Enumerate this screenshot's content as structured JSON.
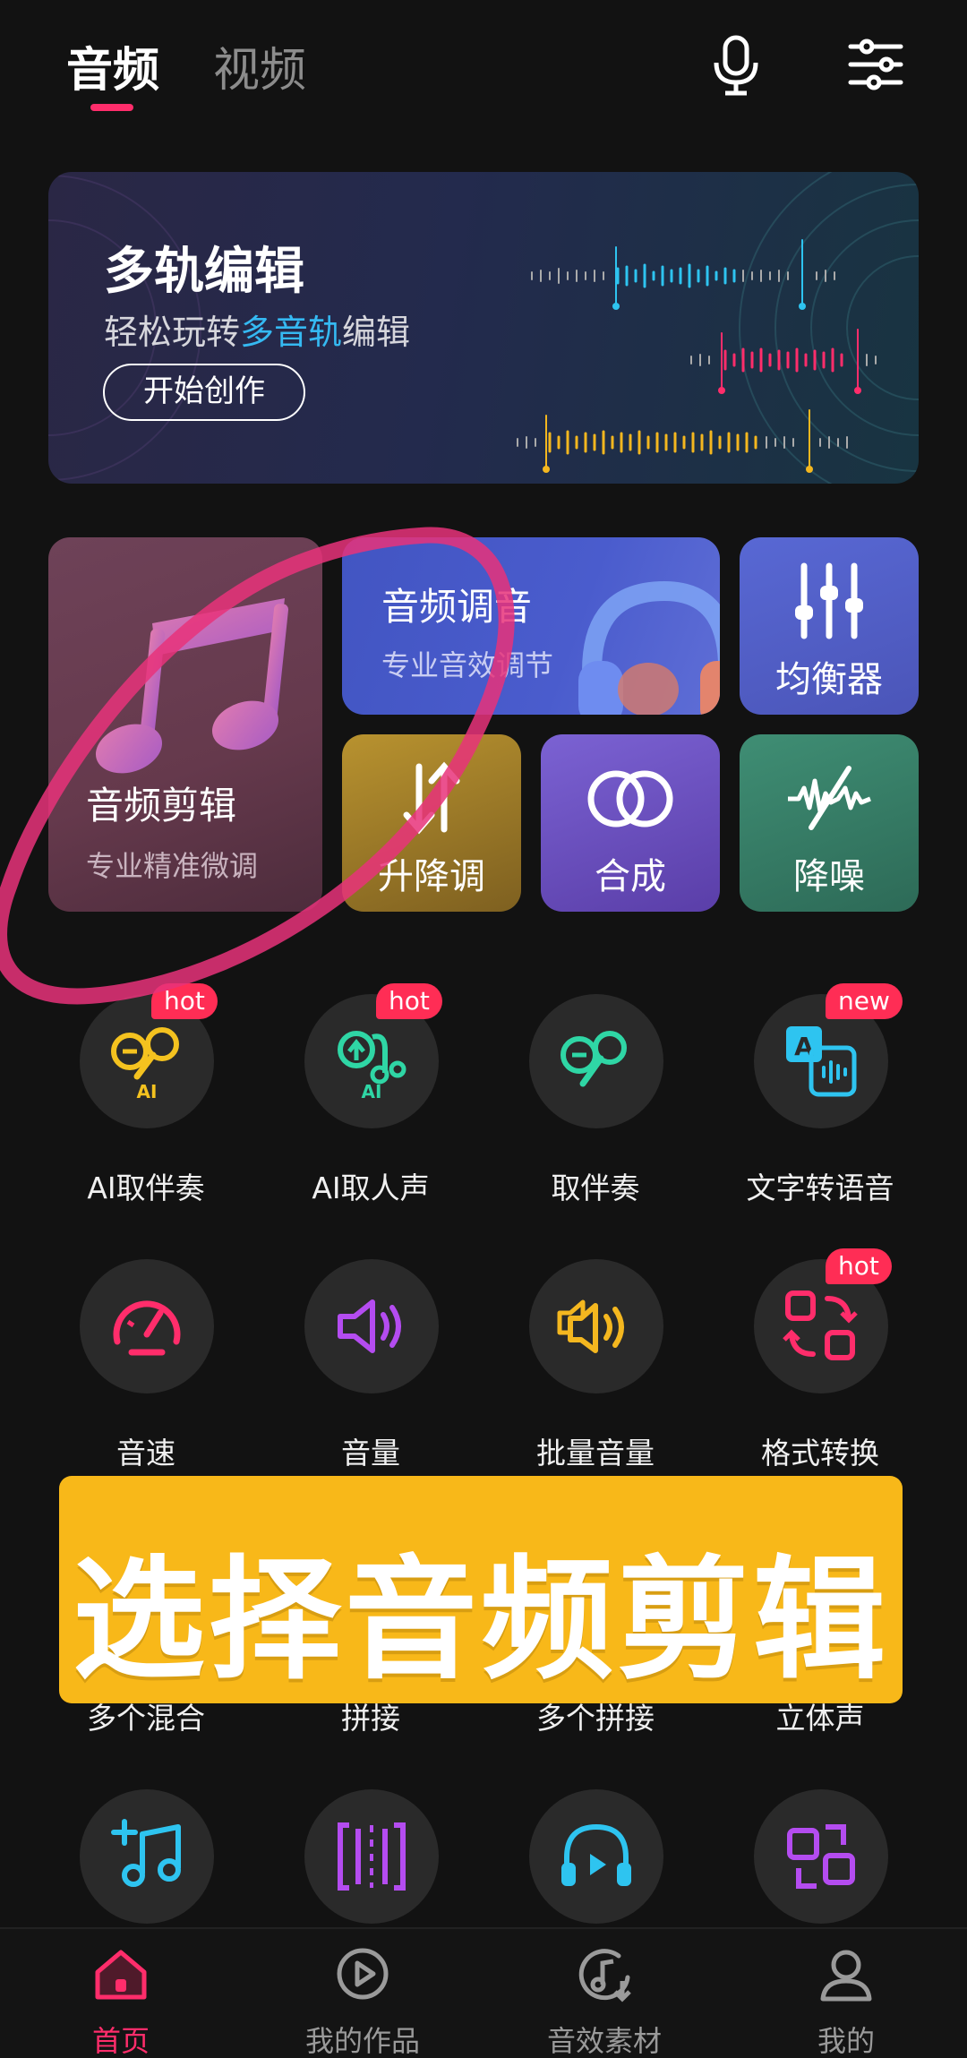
{
  "header": {
    "tabs": [
      {
        "label": "音频",
        "active": true
      },
      {
        "label": "视频",
        "active": false
      }
    ],
    "icons": [
      "microphone-icon",
      "settings-sliders-icon"
    ],
    "accent_color": "#ff2d6b"
  },
  "banner": {
    "title": "多轨编辑",
    "subtitle_prefix": "轻松玩转",
    "subtitle_highlight": "多音轨",
    "subtitle_suffix": "编辑",
    "button_label": "开始创作",
    "waveform_colors": [
      "#2ec4f0",
      "#ff2d6b",
      "#f4b71f"
    ]
  },
  "features": {
    "audio_edit": {
      "title": "音频剪辑",
      "subtitle": "专业精准微调",
      "icon": "music-note-icon"
    },
    "audio_tune": {
      "title": "音频调音",
      "subtitle": "专业音效调节",
      "icon": "headphones-icon"
    },
    "equalizer": {
      "title": "均衡器",
      "icon": "equalizer-icon"
    },
    "pitch": {
      "title": "升降调",
      "icon": "up-down-arrows-icon"
    },
    "mix": {
      "title": "合成",
      "icon": "interlocked-rings-icon"
    },
    "denoise": {
      "title": "降噪",
      "icon": "noise-wave-icon"
    }
  },
  "tools": [
    {
      "label": "AI取伴奏",
      "badge": "hot",
      "icon": "ai-accompaniment-icon",
      "color": "#f4c21f"
    },
    {
      "label": "AI取人声",
      "badge": "hot",
      "icon": "ai-vocal-icon",
      "color": "#2fd6a5"
    },
    {
      "label": "取伴奏",
      "badge": "",
      "icon": "accompaniment-icon",
      "color": "#2fd6a5"
    },
    {
      "label": "文字转语音",
      "badge": "new",
      "icon": "text-to-speech-icon",
      "color": "#2ec4f0"
    },
    {
      "label": "音速",
      "badge": "",
      "icon": "speedometer-icon",
      "color": "#ff2d6b"
    },
    {
      "label": "音量",
      "badge": "",
      "icon": "volume-icon",
      "color": "#b44cf0"
    },
    {
      "label": "批量音量",
      "badge": "",
      "icon": "batch-volume-icon",
      "color": "#f4b71f"
    },
    {
      "label": "格式转换",
      "badge": "hot",
      "icon": "format-convert-icon",
      "color": "#ff2d6b"
    },
    {
      "label": "多个混合",
      "badge": "",
      "icon": "multi-mix-icon",
      "color": "#2ec4f0"
    },
    {
      "label": "拼接",
      "badge": "",
      "icon": "join-icon",
      "color": "#b44cf0"
    },
    {
      "label": "多个拼接",
      "badge": "",
      "icon": "multi-join-icon",
      "color": "#2ec4f0"
    },
    {
      "label": "立体声",
      "badge": "",
      "icon": "stereo-icon",
      "color": "#b44cf0"
    }
  ],
  "overlay": {
    "text": "选择音频剪辑",
    "color": "#f8b819"
  },
  "bottom_nav": [
    {
      "label": "首页",
      "active": true,
      "icon": "home-icon"
    },
    {
      "label": "我的作品",
      "active": false,
      "icon": "my-works-icon"
    },
    {
      "label": "音效素材",
      "active": false,
      "icon": "sound-material-icon"
    },
    {
      "label": "我的",
      "active": false,
      "icon": "profile-icon"
    }
  ]
}
